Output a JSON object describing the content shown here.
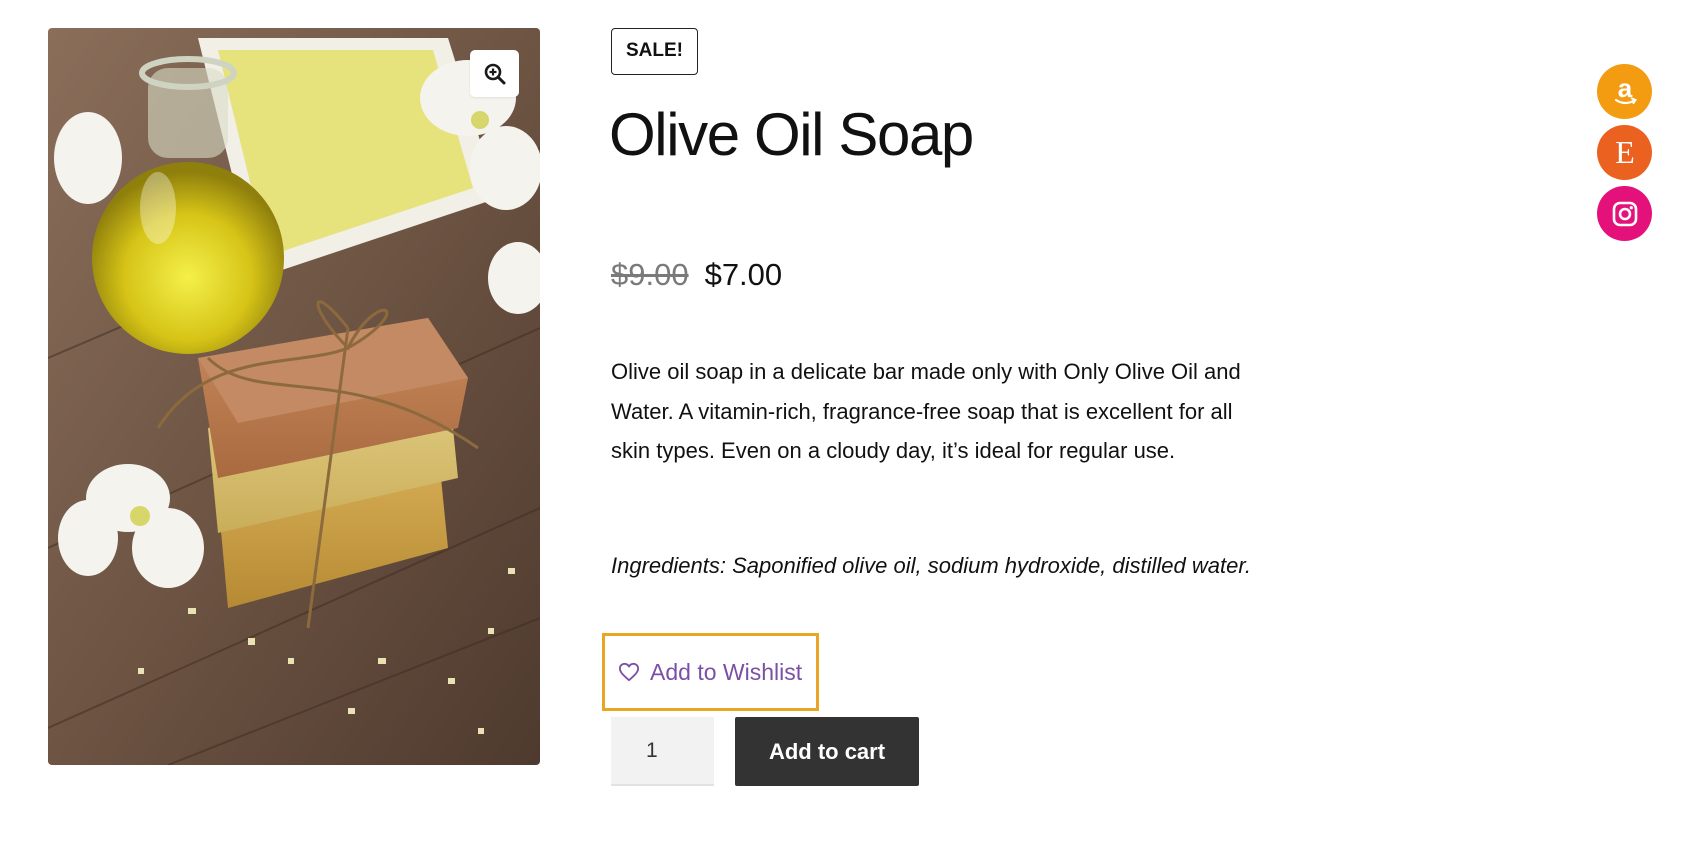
{
  "product": {
    "badge": "SALE!",
    "title": "Olive Oil Soap",
    "price_old": "$9.00",
    "price_new": "$7.00",
    "description": "Olive oil soap in a delicate bar made only with Only Olive Oil and Water. A vitamin-rich, fragrance-free soap that is excellent for all skin types. Even on a cloudy day, it’s ideal for regular use.",
    "ingredients": "Ingredients: Saponified olive oil, sodium hydroxide, distilled water.",
    "image_icon": "zoom-in-icon"
  },
  "wishlist": {
    "label": "Add to Wishlist",
    "icon": "heart-icon",
    "highlight_color": "#eaa524",
    "text_color": "#7b4fa6"
  },
  "cart": {
    "quantity": "1",
    "button_label": "Add to cart",
    "button_color": "#333333"
  },
  "social": [
    {
      "name": "amazon",
      "icon": "amazon-icon",
      "color": "#f39c12",
      "glyph": "a"
    },
    {
      "name": "etsy",
      "icon": "etsy-icon",
      "color": "#eb6120",
      "glyph": "E"
    },
    {
      "name": "instagram",
      "icon": "instagram-icon",
      "color": "#e4117a",
      "glyph": ""
    }
  ]
}
